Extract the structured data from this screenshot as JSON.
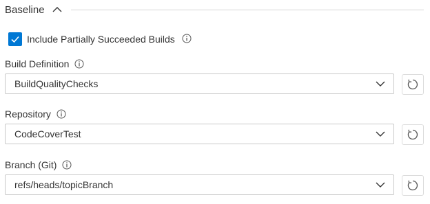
{
  "section": {
    "title": "Baseline"
  },
  "checkbox": {
    "label": "Include Partially Succeeded Builds",
    "checked": true
  },
  "fields": [
    {
      "label": "Build Definition",
      "value": "BuildQualityChecks"
    },
    {
      "label": "Repository",
      "value": "CodeCoverTest"
    },
    {
      "label": "Branch (Git)",
      "value": "refs/heads/topicBranch"
    }
  ],
  "colors": {
    "accent": "#0078d4",
    "border": "#c8c8c8",
    "text": "#333333",
    "icon": "#555555"
  },
  "icons": {
    "collapse": "chevron-up-icon",
    "checkbox": "check-icon",
    "info": "info-icon",
    "dropdown": "chevron-down-icon",
    "refresh": "refresh-icon"
  }
}
